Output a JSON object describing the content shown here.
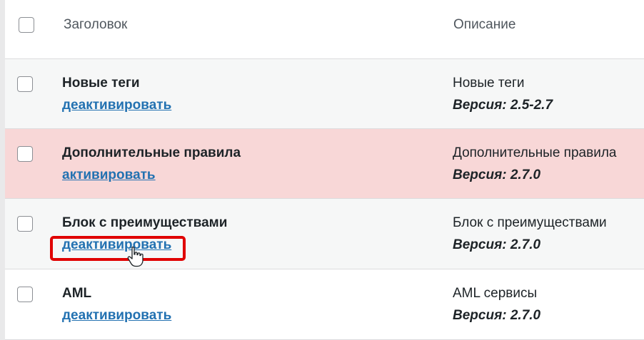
{
  "header": {
    "title_col": "Заголовок",
    "desc_col": "Описание"
  },
  "rows": [
    {
      "title": "Новые теги",
      "action": "деактивировать",
      "description": "Новые теги",
      "version": "Версия: 2.5-2.7",
      "state": "active"
    },
    {
      "title": "Дополнительные правила",
      "action": "активировать",
      "description": "Дополнительные правила",
      "version": "Версия: 2.7.0",
      "state": "inactive"
    },
    {
      "title": "Блок с преимуществами",
      "action": "деактивировать",
      "description": "Блок с преимуществами",
      "version": "Версия: 2.7.0",
      "state": "active"
    },
    {
      "title": "AML",
      "action": "деактивировать",
      "description": "AML сервисы",
      "version": "Версия: 2.7.0",
      "state": "active"
    }
  ],
  "colors": {
    "link": "#2271b1",
    "inactive_row": "#f8d7d7",
    "alt_row": "#f6f7f7",
    "highlight": "#e00000"
  },
  "icons": {
    "cursor": "hand-pointer-icon"
  }
}
